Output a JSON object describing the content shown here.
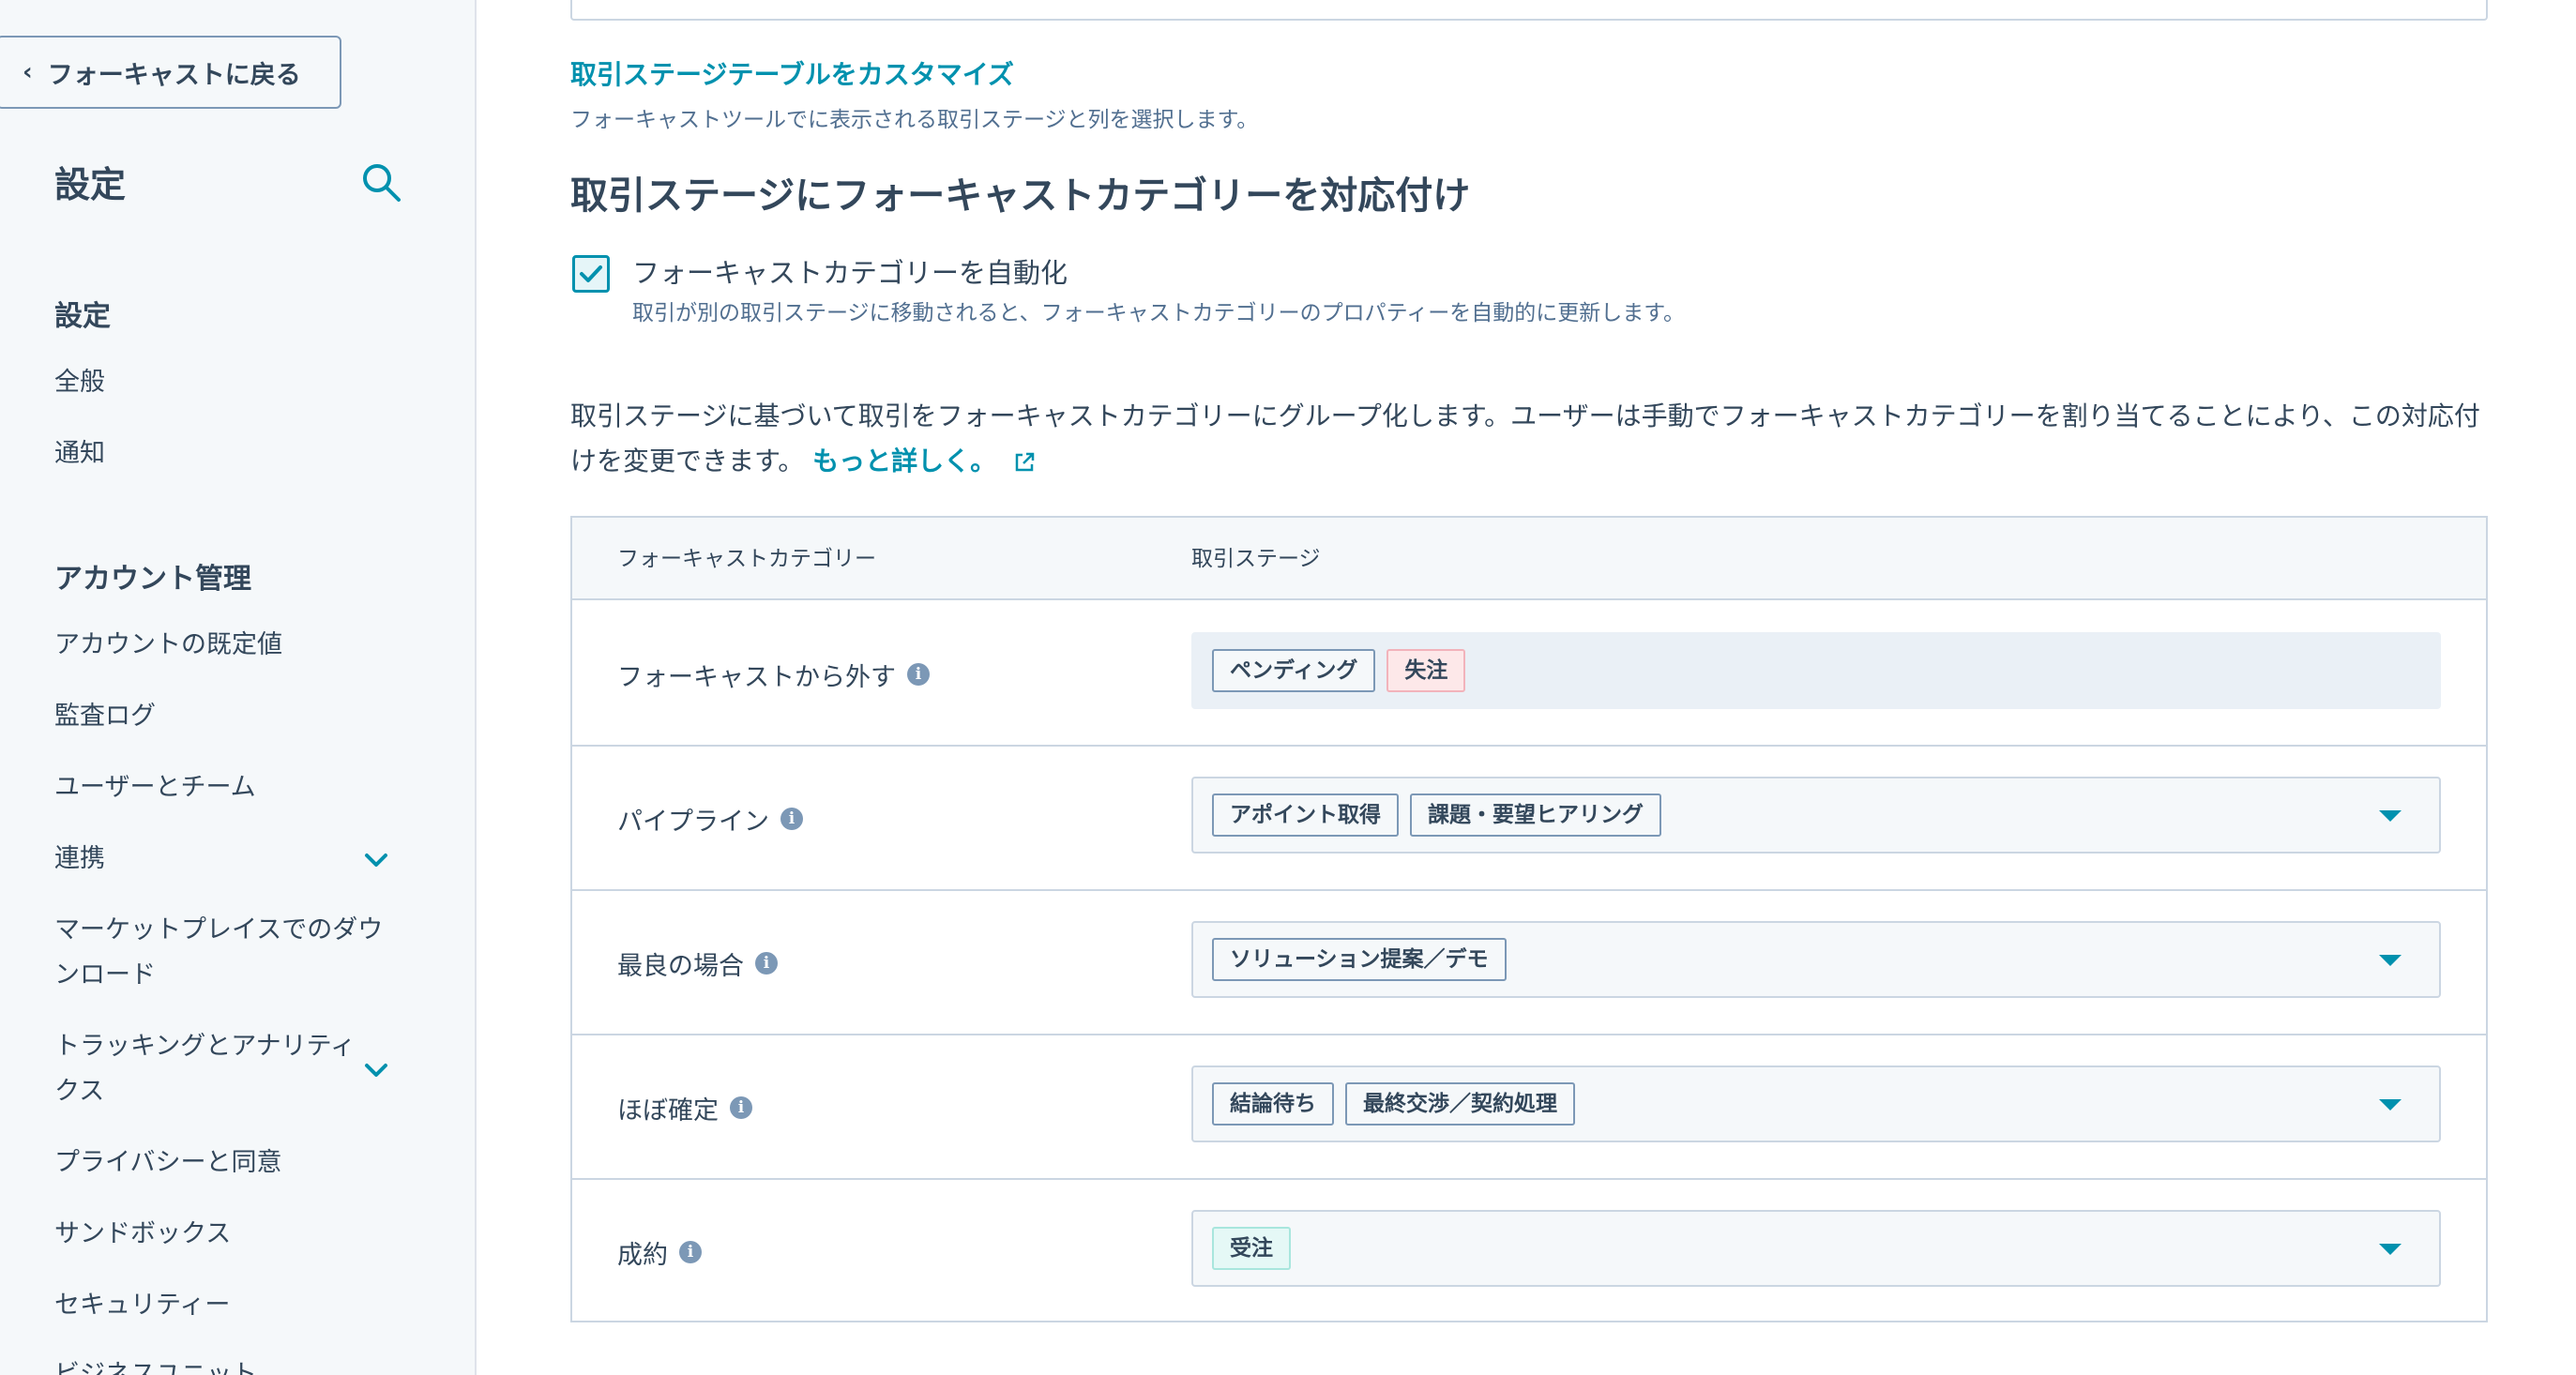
{
  "sidebar": {
    "back_label": "フォーキャストに戻る",
    "title": "設定",
    "section_settings": "設定",
    "settings_items": [
      "全般",
      "通知"
    ],
    "section_account": "アカウント管理",
    "account_items": [
      "アカウントの既定値",
      "監査ログ",
      "ユーザーとチーム",
      "連携",
      "マーケットプレイスでのダウンロード",
      "トラッキングとアナリティクス",
      "プライバシーと同意",
      "サンドボックス",
      "セキュリティー",
      "ビジネスユニット"
    ]
  },
  "main": {
    "customize_link": "取引ステージテーブルをカスタマイズ",
    "customize_desc": "フォーキャストツールでに表示される取引ステージと列を選択します。",
    "section_title": "取引ステージにフォーキャストカテゴリーを対応付け",
    "auto_checkbox_checked": true,
    "auto_label": "フォーキャストカテゴリーを自動化",
    "auto_desc": "取引が別の取引ステージに移動されると、フォーキャストカテゴリーのプロパティーを自動的に更新します。",
    "explain": "取引ステージに基づいて取引をフォーキャストカテゴリーにグループ化します。ユーザーは手動でフォーキャストカテゴリーを割り当てることにより、この対応付けを変更できます。",
    "learn_more": "もっと詳しく。"
  },
  "table": {
    "headers": [
      "フォーキャストカテゴリー",
      "取引ステージ"
    ],
    "rows": [
      {
        "category": "フォーキャストから外す",
        "stages": [
          "ペンディング",
          "失注"
        ]
      },
      {
        "category": "パイプライン",
        "stages": [
          "アポイント取得",
          "課題・要望ヒアリング"
        ]
      },
      {
        "category": "最良の場合",
        "stages": [
          "ソリューション提案／デモ"
        ]
      },
      {
        "category": "ほぼ確定",
        "stages": [
          "結論待ち",
          "最終交渉／契約処理"
        ]
      },
      {
        "category": "成約",
        "stages": [
          "受注"
        ]
      }
    ]
  },
  "colors": {
    "accent": "#0091ae",
    "text": "#33475b",
    "border": "#cbd6e2",
    "lost_tag_bg": "#fde8e9",
    "won_tag_bg": "#e5f8f6"
  },
  "icons": [
    "chevron-left-icon",
    "search-icon",
    "chevron-down-icon",
    "check-icon",
    "external-link-icon",
    "info-icon",
    "caret-down-icon"
  ]
}
